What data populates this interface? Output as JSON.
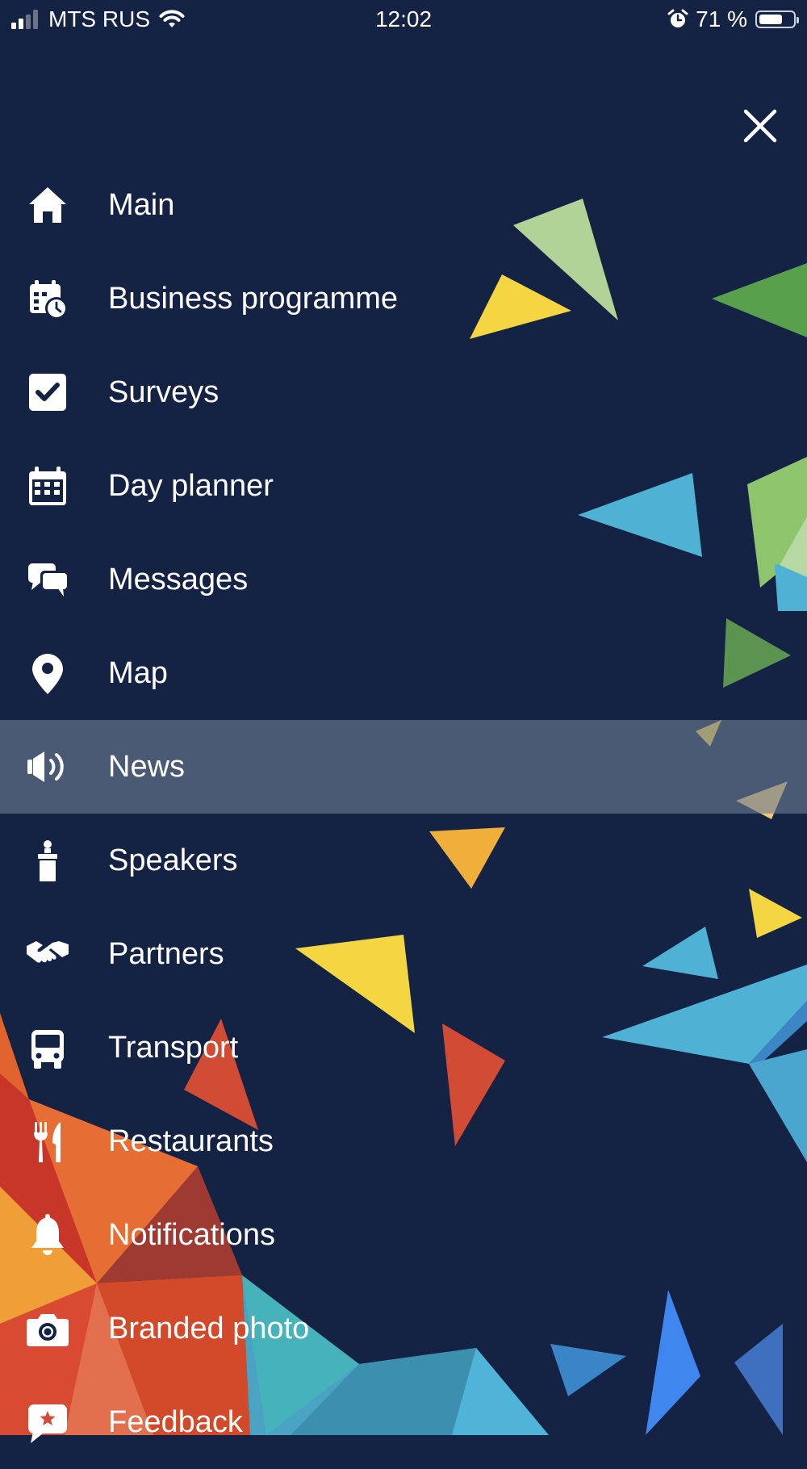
{
  "status_bar": {
    "carrier": "MTS RUS",
    "time": "12:02",
    "battery_text": "71 %",
    "battery_level": 0.71,
    "signal_bars_on": 2,
    "signal_bars_total": 4
  },
  "close_icon": "close-icon",
  "menu": {
    "active_index": 6,
    "items": [
      {
        "label": "Main",
        "icon": "home-icon"
      },
      {
        "label": "Business programme",
        "icon": "calendar-clock-icon"
      },
      {
        "label": "Surveys",
        "icon": "checkbox-icon"
      },
      {
        "label": "Day planner",
        "icon": "calendar-icon"
      },
      {
        "label": "Messages",
        "icon": "chat-bubbles-icon"
      },
      {
        "label": "Map",
        "icon": "map-pin-icon"
      },
      {
        "label": "News",
        "icon": "megaphone-icon"
      },
      {
        "label": "Speakers",
        "icon": "speaker-podium-icon"
      },
      {
        "label": "Partners",
        "icon": "handshake-icon"
      },
      {
        "label": "Transport",
        "icon": "bus-icon"
      },
      {
        "label": "Restaurants",
        "icon": "cutlery-icon"
      },
      {
        "label": "Notifications",
        "icon": "bell-icon"
      },
      {
        "label": "Branded photo",
        "icon": "camera-icon"
      },
      {
        "label": "Feedback",
        "icon": "feedback-star-icon"
      }
    ]
  },
  "colors": {
    "background": "#142244",
    "active_row": "#4a5670",
    "text": "#ffffff"
  }
}
